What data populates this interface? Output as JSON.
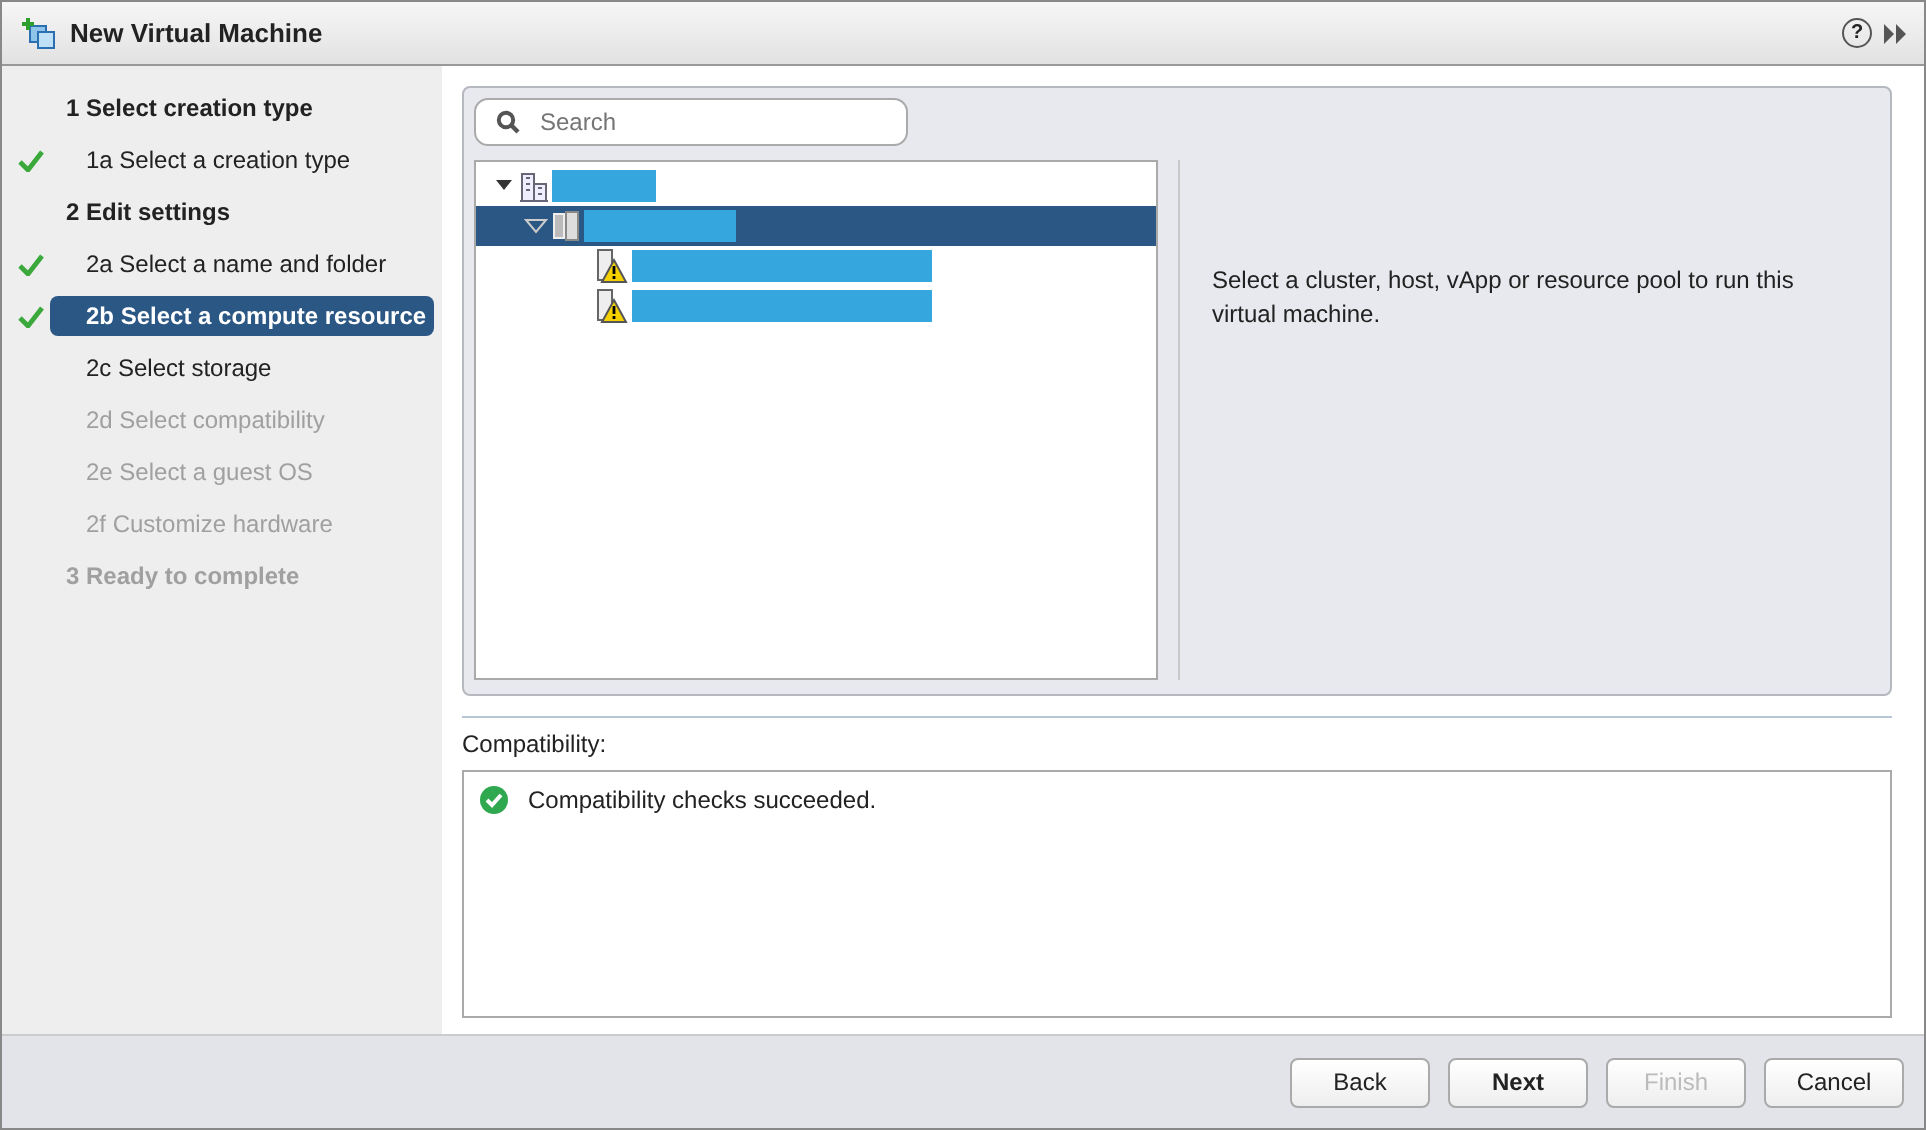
{
  "window": {
    "title": "New Virtual Machine",
    "help": "?"
  },
  "steps": [
    {
      "label": "1  Select creation type",
      "kind": "group",
      "done": false,
      "selected": false,
      "disabled": false
    },
    {
      "label": "1a  Select a creation type",
      "kind": "step",
      "done": true,
      "selected": false,
      "disabled": false
    },
    {
      "label": "2  Edit settings",
      "kind": "group",
      "done": false,
      "selected": false,
      "disabled": false
    },
    {
      "label": "2a  Select a name and folder",
      "kind": "step",
      "done": true,
      "selected": false,
      "disabled": false
    },
    {
      "label": "2b  Select a compute resource",
      "kind": "step",
      "done": true,
      "selected": true,
      "disabled": false
    },
    {
      "label": "2c  Select storage",
      "kind": "step",
      "done": false,
      "selected": false,
      "disabled": false
    },
    {
      "label": "2d  Select compatibility",
      "kind": "step",
      "done": false,
      "selected": false,
      "disabled": true
    },
    {
      "label": "2e  Select a guest OS",
      "kind": "step",
      "done": false,
      "selected": false,
      "disabled": true
    },
    {
      "label": "2f  Customize hardware",
      "kind": "step",
      "done": false,
      "selected": false,
      "disabled": true
    },
    {
      "label": "3  Ready to complete",
      "kind": "group",
      "done": false,
      "selected": false,
      "disabled": true
    }
  ],
  "search": {
    "placeholder": "Search"
  },
  "tree": [
    {
      "kind": "datacenter",
      "expanded": true,
      "selected": false,
      "children": [
        {
          "kind": "cluster",
          "expanded": true,
          "selected": true,
          "children": [
            {
              "kind": "host",
              "warning": true,
              "selected": false
            },
            {
              "kind": "host",
              "warning": true,
              "selected": false
            }
          ]
        }
      ]
    }
  ],
  "info": "Select a cluster, host, vApp or resource pool to run this virtual machine.",
  "compatibility": {
    "label": "Compatibility:",
    "message": "Compatibility checks succeeded.",
    "ok": true
  },
  "buttons": [
    {
      "label": "Back",
      "primary": false,
      "disabled": false
    },
    {
      "label": "Next",
      "primary": true,
      "disabled": false
    },
    {
      "label": "Finish",
      "primary": false,
      "disabled": true
    },
    {
      "label": "Cancel",
      "primary": false,
      "disabled": false
    }
  ]
}
